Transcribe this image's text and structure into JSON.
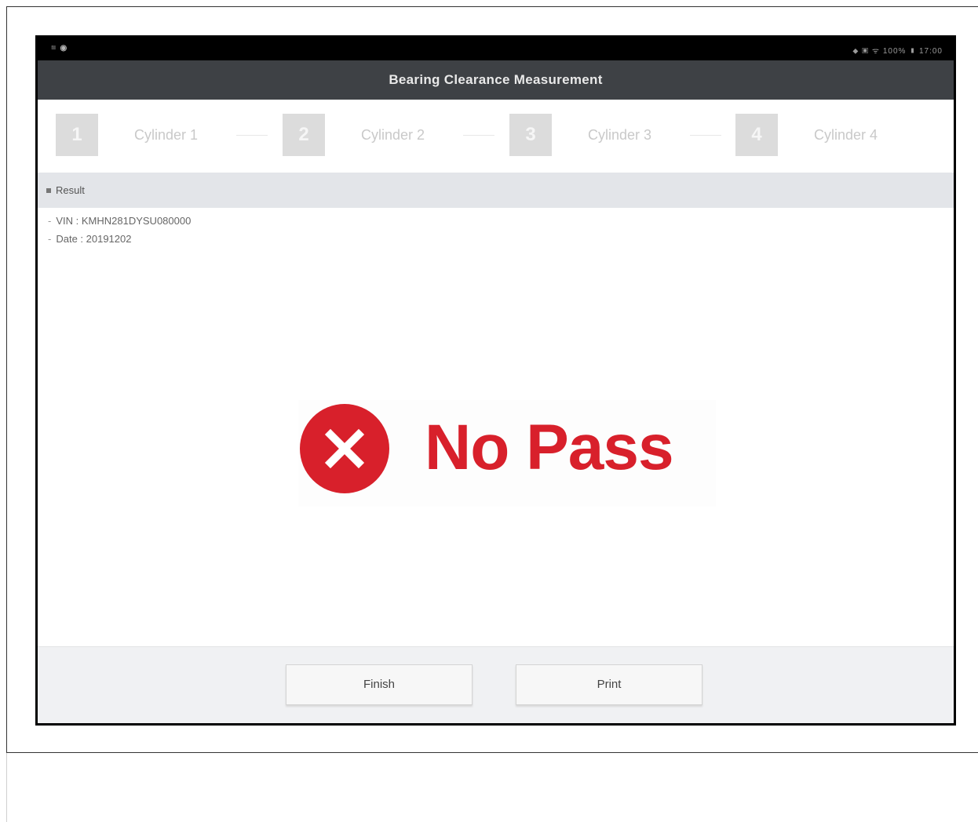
{
  "status_bar": {
    "left_icons": "◾◉",
    "right_text": "⬥ ▣ ᯤ 100% ▮ 17:00"
  },
  "header": {
    "title": "Bearing Clearance Measurement"
  },
  "steps": [
    {
      "number": "1",
      "label": "Cylinder 1"
    },
    {
      "number": "2",
      "label": "Cylinder 2"
    },
    {
      "number": "3",
      "label": "Cylinder 3"
    },
    {
      "number": "4",
      "label": "Cylinder 4"
    }
  ],
  "result_section": {
    "header": "Result",
    "vin_label": "VIN : ",
    "vin_value": "KMHN281DYSU080000",
    "date_label": "Date : ",
    "date_value": "20191202",
    "result_text": "No Pass",
    "result_icon": "x-circle-icon",
    "result_color": "#d8202b"
  },
  "footer": {
    "finish_label": "Finish",
    "print_label": "Print"
  },
  "colors": {
    "title_bar": "#3e4145",
    "status_bar": "#000000",
    "section_header": "#e3e5e9",
    "footer": "#f0f1f3"
  }
}
